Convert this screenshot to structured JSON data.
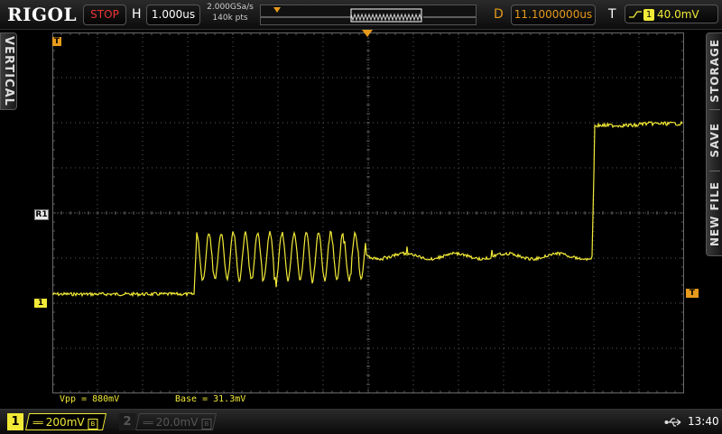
{
  "header": {
    "brand": "RIGOL",
    "run_status": "STOP",
    "timebase_label": "H",
    "timebase_scale": "1.000us",
    "sample_rate": "2.000GSa/s",
    "memory_depth": "140k pts",
    "delay_label": "D",
    "delay_value": "11.1000000us",
    "trigger_label": "T",
    "trigger_source": "1",
    "trigger_level": "40.0mV"
  },
  "side_tabs": {
    "left": "VERTICAL",
    "right": [
      "STORAGE",
      "SAVE",
      "NEW FILE"
    ]
  },
  "markers": {
    "trigger_time": "T",
    "channel1": "1",
    "reference": "R1",
    "trigger_level": "T"
  },
  "measurements": {
    "vpp": "Vpp = 880mV",
    "base": "Base = 31.3mV"
  },
  "channels": [
    {
      "number": "1",
      "scale": "200mV",
      "coupling": "DC",
      "bw": "B",
      "active": true
    },
    {
      "number": "2",
      "scale": "20.0mV",
      "coupling": "DC",
      "bw": "B",
      "active": false
    }
  ],
  "status_bar": {
    "clock": "13:40",
    "usb_icon": "usb-icon"
  },
  "colors": {
    "channel1": "#f2ea37",
    "trigger": "#e79a1b",
    "stop": "#ee3333",
    "grid": "#5a5a5a"
  }
}
